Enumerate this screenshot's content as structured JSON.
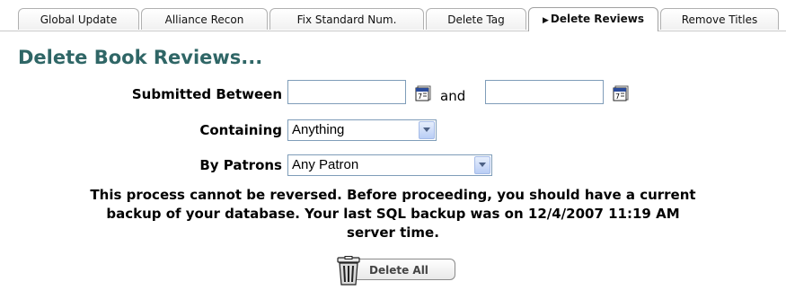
{
  "tabs": [
    {
      "label": "Global Update"
    },
    {
      "label": "Alliance Recon"
    },
    {
      "label": "Fix Standard Num."
    },
    {
      "label": "Delete Tag"
    },
    {
      "label": "Delete Reviews",
      "active": true
    },
    {
      "label": "Remove Titles"
    }
  ],
  "form": {
    "title": "Delete Book Reviews...",
    "submitted_between_label": "Submitted Between",
    "date_from_value": "",
    "and_label": "and",
    "date_to_value": "",
    "containing_label": "Containing",
    "containing_selected": "Anything",
    "by_patrons_label": "By Patrons",
    "by_patrons_selected": "Any Patron"
  },
  "warning": {
    "line1": "This process cannot be reversed. Before proceeding, you should have a current",
    "line2": "backup of your database. Your last SQL backup was on 12/4/2007 11:19 AM",
    "line3": "server time."
  },
  "delete_button": {
    "label": "Delete All"
  },
  "icons": {
    "calendar": "calendar-icon",
    "trash": "trash-can-icon",
    "active_tab_arrow": "triangle-right-icon"
  },
  "colors": {
    "title": "#2f6666",
    "input_border": "#7f9db9"
  }
}
